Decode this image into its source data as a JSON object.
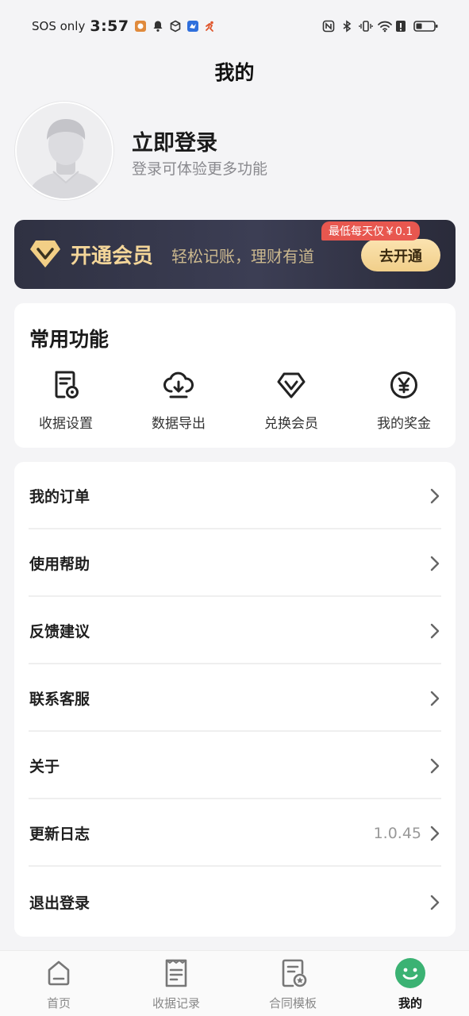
{
  "status_bar": {
    "carrier": "SOS only",
    "time": "3:57"
  },
  "page_title": "我的",
  "profile": {
    "login_title": "立即登录",
    "login_subtitle": "登录可体验更多功能"
  },
  "vip_banner": {
    "title": "开通会员",
    "slogan": "轻松记账，理财有道",
    "badge": "最低每天仅￥0.1",
    "button": "去开通",
    "colors": {
      "title": "#f4d699",
      "button": "#f1cf8a",
      "badge": "#e8574f"
    }
  },
  "common_functions": {
    "title": "常用功能",
    "items": [
      {
        "label": "收据设置",
        "icon": "receipt-settings-icon"
      },
      {
        "label": "数据导出",
        "icon": "cloud-download-icon"
      },
      {
        "label": "兑换会员",
        "icon": "vip-diamond-icon"
      },
      {
        "label": "我的奖金",
        "icon": "yen-coin-icon"
      }
    ]
  },
  "menu": {
    "items": [
      {
        "label": "我的订单",
        "value": ""
      },
      {
        "label": "使用帮助",
        "value": ""
      },
      {
        "label": "反馈建议",
        "value": ""
      },
      {
        "label": "联系客服",
        "value": ""
      },
      {
        "label": "关于",
        "value": ""
      },
      {
        "label": "更新日志",
        "value": "1.0.45"
      },
      {
        "label": "退出登录",
        "value": ""
      }
    ]
  },
  "tab_bar": {
    "active_color": "#3bb273",
    "items": [
      {
        "label": "首页",
        "icon": "home-icon",
        "active": false
      },
      {
        "label": "收据记录",
        "icon": "receipt-list-icon",
        "active": false
      },
      {
        "label": "合同模板",
        "icon": "contract-template-icon",
        "active": false
      },
      {
        "label": "我的",
        "icon": "smile-icon",
        "active": true
      }
    ]
  }
}
